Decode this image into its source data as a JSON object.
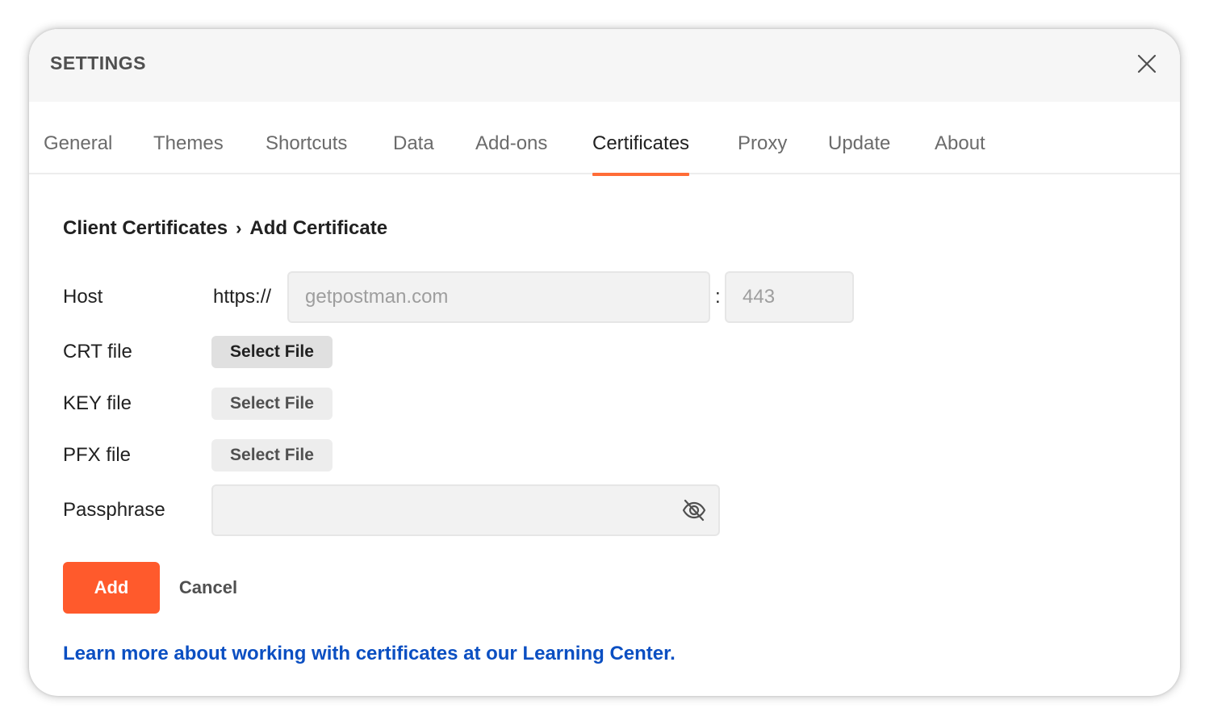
{
  "header": {
    "title": "SETTINGS",
    "close_icon": "close-icon"
  },
  "tabs": [
    {
      "label": "General"
    },
    {
      "label": "Themes"
    },
    {
      "label": "Shortcuts"
    },
    {
      "label": "Data"
    },
    {
      "label": "Add-ons"
    },
    {
      "label": "Certificates",
      "active": true
    },
    {
      "label": "Proxy"
    },
    {
      "label": "Update"
    },
    {
      "label": "About"
    }
  ],
  "breadcrumb": {
    "parent": "Client Certificates",
    "separator": "›",
    "current": "Add Certificate"
  },
  "form": {
    "host_label": "Host",
    "protocol": "https://",
    "host_placeholder": "getpostman.com",
    "host_value": "",
    "colon": ":",
    "port_placeholder": "443",
    "port_value": "",
    "crt_label": "CRT file",
    "key_label": "KEY file",
    "pfx_label": "PFX file",
    "select_file_label": "Select File",
    "passphrase_label": "Passphrase",
    "passphrase_value": "",
    "passphrase_toggle_icon": "eye-off-icon"
  },
  "actions": {
    "add_label": "Add",
    "cancel_label": "Cancel"
  },
  "learn_more": "Learn more about working with certificates at our Learning Center.",
  "colors": {
    "accent": "#ff6c37",
    "primary_button": "#ff5a2c",
    "link": "#0b4fc2",
    "header_bg": "#f6f6f6"
  }
}
